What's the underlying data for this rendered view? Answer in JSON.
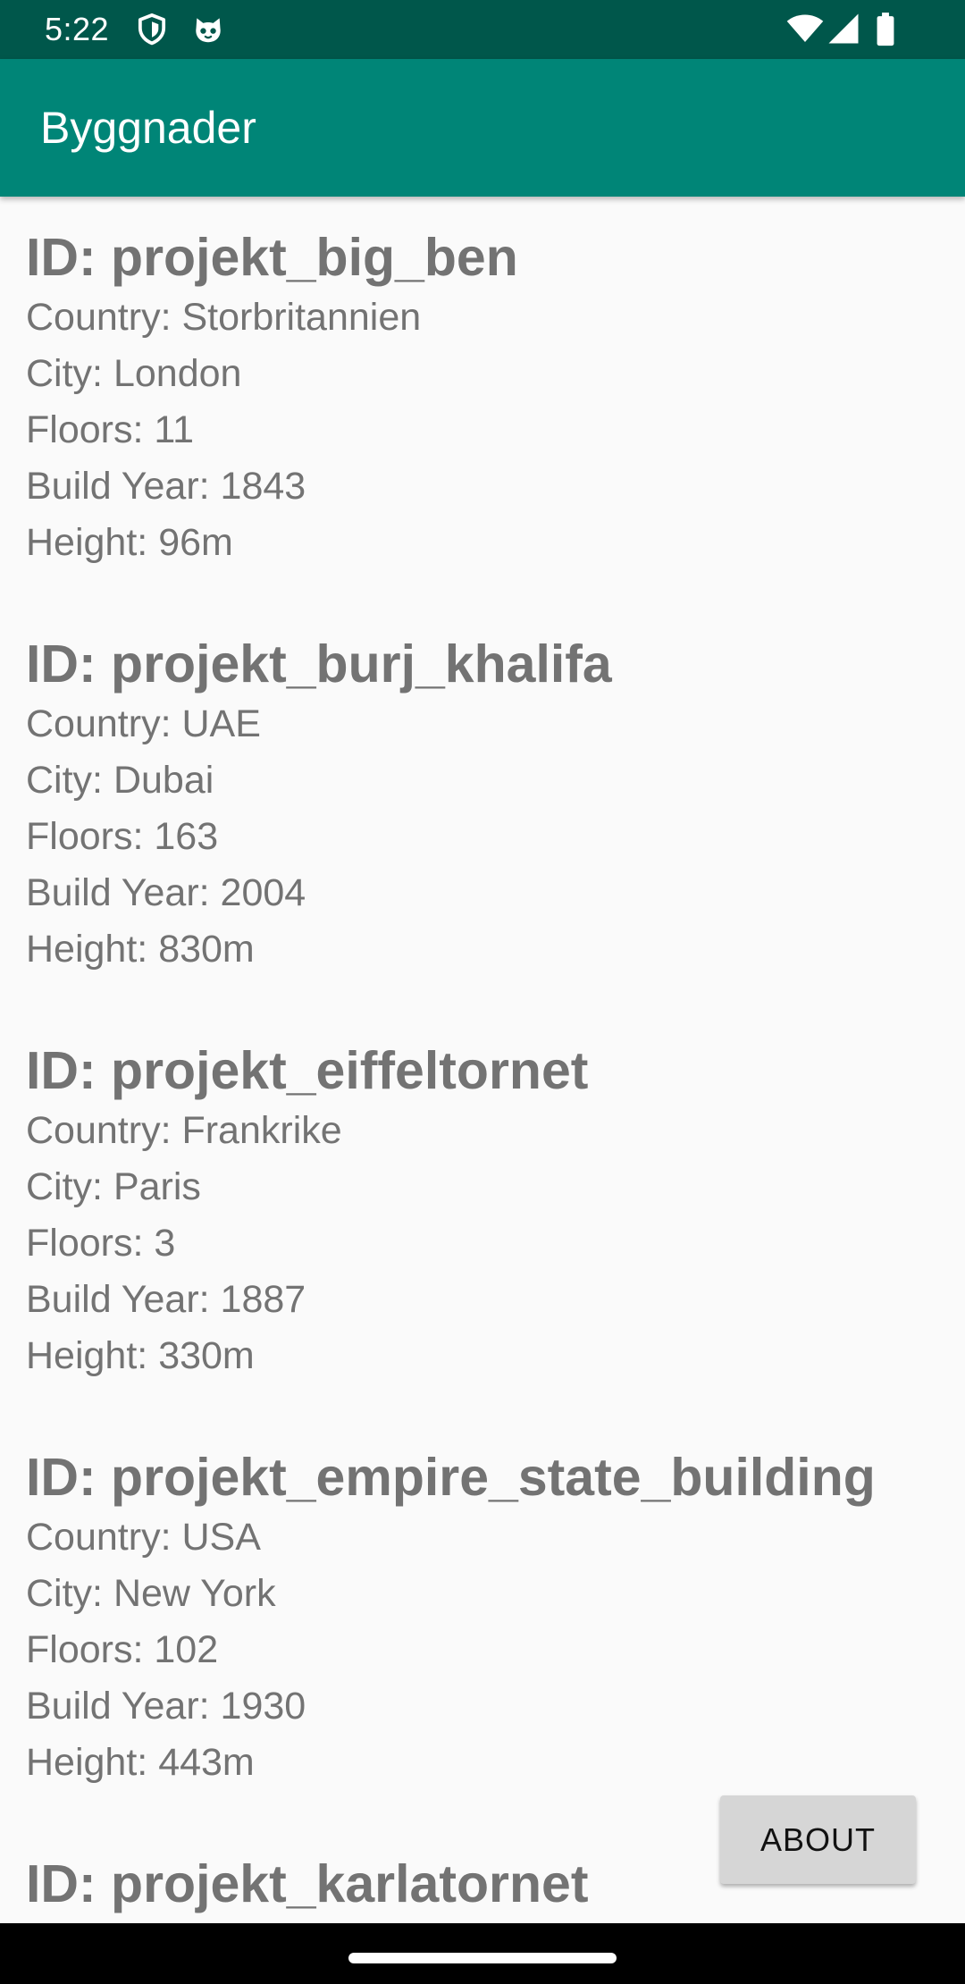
{
  "status_bar": {
    "time": "5:22",
    "icons": [
      "shield-icon",
      "cat-face-icon",
      "wifi-icon",
      "cellular-signal-icon",
      "battery-icon"
    ],
    "background": "#00574b"
  },
  "app_bar": {
    "title": "Byggnader",
    "background": "#008577"
  },
  "buildings": [
    {
      "id": "ID: projekt_big_ben",
      "country": "Country: Storbritannien",
      "city": "City: London",
      "floors": "Floors: 11",
      "build_year": "Build Year: 1843",
      "height": "Height: 96m"
    },
    {
      "id": "ID: projekt_burj_khalifa",
      "country": "Country: UAE",
      "city": "City: Dubai",
      "floors": "Floors: 163",
      "build_year": "Build Year: 2004",
      "height": "Height: 830m"
    },
    {
      "id": "ID: projekt_eiffeltornet",
      "country": "Country: Frankrike",
      "city": "City: Paris",
      "floors": "Floors: 3",
      "build_year": "Build Year: 1887",
      "height": "Height: 330m"
    },
    {
      "id": "ID: projekt_empire_state_building",
      "country": "Country: USA",
      "city": "City: New York",
      "floors": "Floors: 102",
      "build_year": "Build Year: 1930",
      "height": "Height: 443m"
    },
    {
      "id": "ID: projekt_karlatornet"
    }
  ],
  "about_button": {
    "label": "ABOUT"
  },
  "colors": {
    "text": "#737373",
    "background": "#fafafa",
    "button": "#d6d6d6"
  }
}
